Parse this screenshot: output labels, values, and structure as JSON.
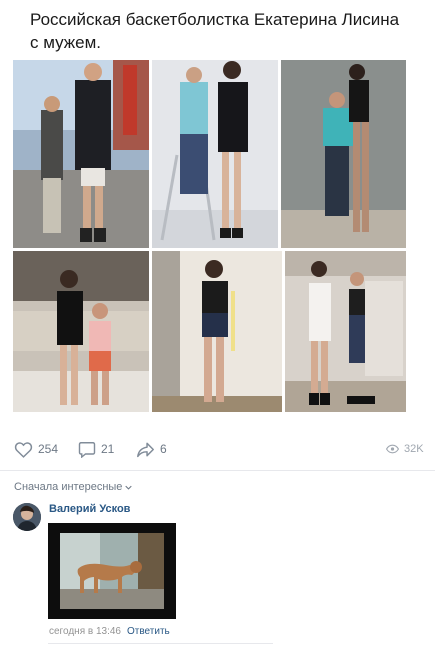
{
  "post": {
    "text": "Российская баскетболистка Екатерина Лисина с мужем."
  },
  "actions": {
    "likes": "254",
    "comments": "21",
    "shares": "6",
    "views": "32K"
  },
  "comments_section": {
    "sort_label": "Сначала интересные",
    "comment": {
      "author": "Валерий Усков",
      "time": "сегодня в 13:46",
      "reply_label": "Ответить"
    }
  },
  "colors": {
    "link": "#2a5885",
    "muted": "#6d7885",
    "divider": "#e7e8ec"
  },
  "icons": [
    "heart-icon",
    "comment-icon",
    "share-icon",
    "eye-icon",
    "chevron-down-icon"
  ]
}
